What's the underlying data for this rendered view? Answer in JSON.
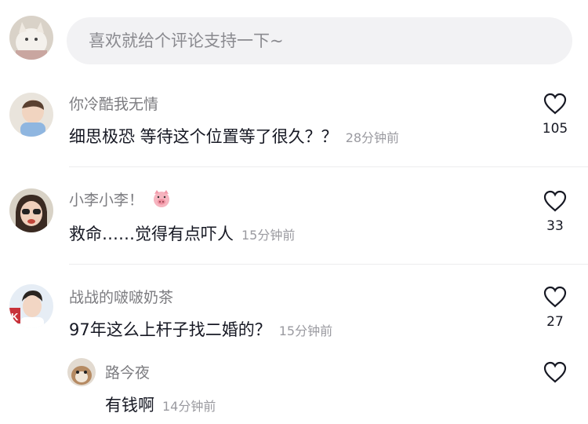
{
  "input": {
    "placeholder": "喜欢就给个评论支持一下~"
  },
  "comments": [
    {
      "user": "你冷酷我无情",
      "text": "细思极恐 等待这个位置等了很久？？",
      "time": "28分钟前",
      "likes": "105"
    },
    {
      "user": "小李小李！",
      "user_emoji": "pig-face-icon",
      "text": "救命……觉得有点吓人",
      "time": "15分钟前",
      "likes": "33"
    },
    {
      "user": "战战的啵啵奶茶",
      "text": "97年这么上杆子找二婚的？",
      "time": "15分钟前",
      "likes": "27"
    },
    {
      "user": "路今夜",
      "text": "有钱啊",
      "time": "14分钟前",
      "likes": ""
    }
  ],
  "colors": {
    "primary_text": "#161823",
    "secondary_text": "#7c7c80",
    "time_text": "#9a9aa0",
    "input_bg": "#f2f2f4"
  }
}
